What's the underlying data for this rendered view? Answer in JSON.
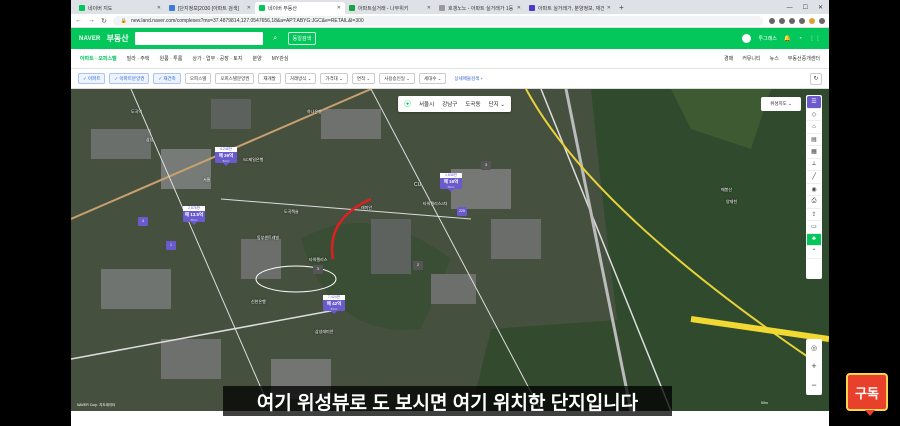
{
  "browser": {
    "tabs": [
      {
        "label": "네이버 지도",
        "color": "#03c75a",
        "active": false
      },
      {
        "label": "[단지정보]2030 [아파트 검색]",
        "color": "#3f7bd9",
        "active": false
      },
      {
        "label": "네이버 부동산",
        "color": "#03c75a",
        "active": true
      },
      {
        "label": "아파트실거래 - 나무위키",
        "color": "#16a34a",
        "active": false
      },
      {
        "label": "호갱노노 - 아파트 실거래가 1등",
        "color": "#999999",
        "active": false
      },
      {
        "label": "아파트 실거래가, 분양정보, 재건",
        "color": "#4b39c8",
        "active": false
      }
    ],
    "url": "new.land.naver.com/complexes?ms=37.4879814,127.0547656,18&a=APT:ABYG:JGC&e=RETAIL&l=300"
  },
  "naver_header": {
    "logo": "NAVER",
    "service": "부동산",
    "button": "동일검색",
    "user": "투그래스",
    "bell_icon": "bell-icon"
  },
  "menu": {
    "items": [
      "아파트 · 오피스텔",
      "빌라 · 주택",
      "원룸 · 투룸",
      "상가 · 업무 · 공장 · 토지",
      "분양",
      "MY관심"
    ],
    "right": [
      "경매",
      "커뮤니티",
      "뉴스",
      "부동산중개센터"
    ]
  },
  "filters": {
    "chips": [
      "아파트",
      "아파트분양권",
      "재건축",
      "오피스텔",
      "오피스텔분양권",
      "재개발",
      "거래방식",
      "가격대",
      "면적",
      "사용승인일",
      "세대수"
    ],
    "selected": [
      0,
      1,
      2
    ],
    "detail_link": "상세매물검색"
  },
  "map": {
    "location": [
      "서울시",
      "강남구",
      "도곡동",
      "단지"
    ],
    "view_mode": "위성지도",
    "cu_label": "CU",
    "markers": [
      {
        "top": "4,248만",
        "main": "매 26억",
        "sub": "84m²"
      },
      {
        "top": "1,838만",
        "main": "매 16억",
        "sub": "59m²"
      },
      {
        "top": "2,576만",
        "main": "매 13.5억",
        "sub": "59m²"
      },
      {
        "top": "7,424만",
        "main": "매 42억",
        "sub": "84m²"
      }
    ],
    "small_markers": [
      "4",
      "1",
      "225",
      "3",
      "2",
      "3"
    ],
    "place_labels": [
      "도곡역",
      "SC제일은행",
      "삼성",
      "서울",
      "래미안",
      "타워팰리스",
      "동부센트레빌",
      "도곡렉슬",
      "하나은행",
      "양재천",
      "매봉산",
      "삼성래미안",
      "신한은행",
      "타워팰리스3차"
    ],
    "copyright": "NAVER Corp. 지도데이터",
    "scale": "50m"
  },
  "subtitle": "여기 위성뷰로 도 보시면 여기 위치한 단지입니다",
  "subscribe": "구독",
  "colors": {
    "naver_green": "#03c75a",
    "marker_purple": "#6a5acd",
    "subscribe_red": "#e8402a"
  }
}
